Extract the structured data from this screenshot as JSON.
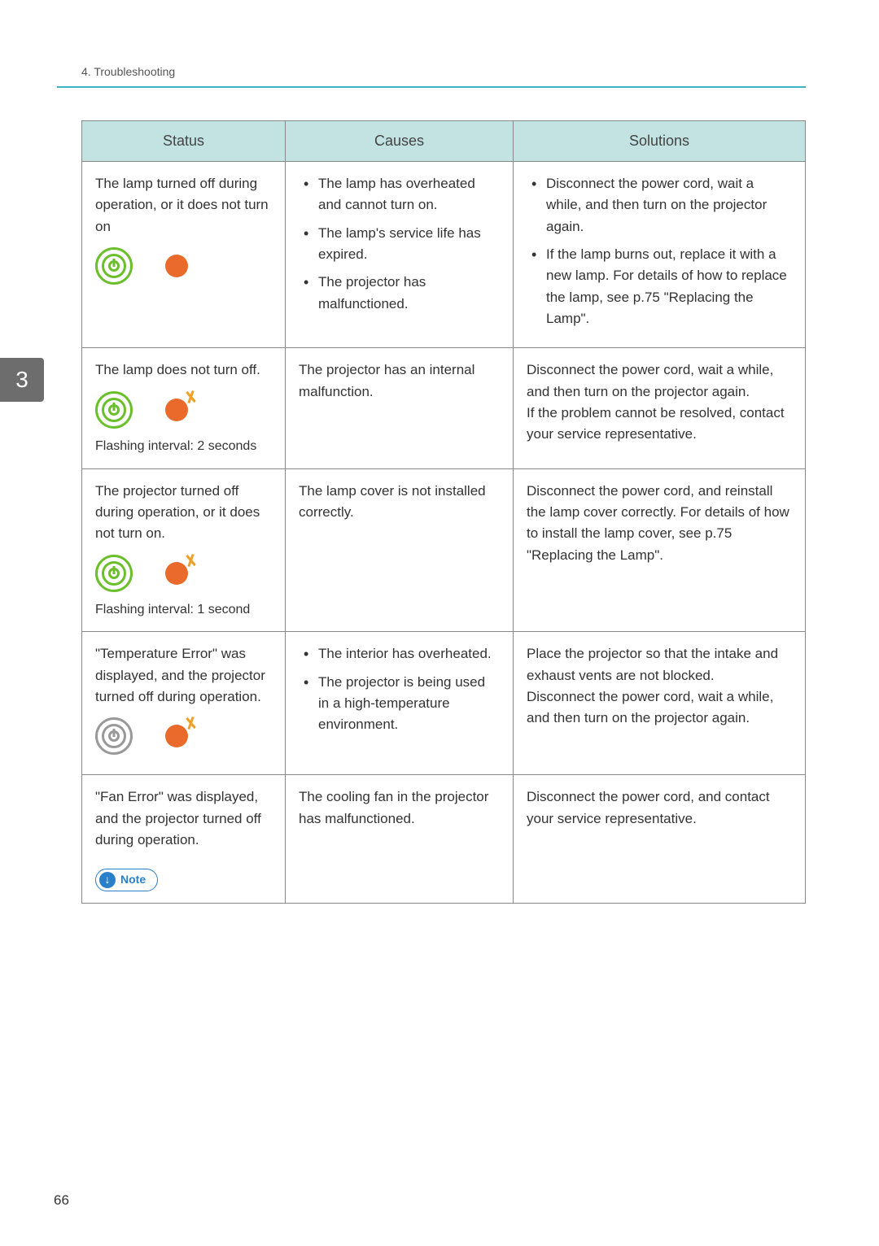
{
  "header": {
    "section": "4. Troubleshooting"
  },
  "side_tab": "3",
  "page_number": "66",
  "note_label": "Note",
  "table": {
    "headers": {
      "status": "Status",
      "causes": "Causes",
      "solutions": "Solutions"
    },
    "rows": [
      {
        "status_text": "The lamp turned off during operation, or it does not turn on",
        "status_footnote": "",
        "causes_items": [
          "The lamp has overheated and cannot turn on.",
          "The lamp's service life has expired.",
          "The projector has malfunctioned."
        ],
        "solutions_items": [
          "Disconnect the power cord, wait a while, and then turn on the projector again.",
          "If the lamp burns out, replace it with a new lamp. For details of how to replace the lamp, see p.75 \"Replacing the Lamp\"."
        ],
        "solutions_plain": "",
        "icons": {
          "power_lit": true,
          "led_type": "solid"
        }
      },
      {
        "status_text": "The lamp does not turn off.",
        "status_footnote": "Flashing interval: 2 seconds",
        "causes_plain": "The projector has an internal malfunction.",
        "solutions_plain": "Disconnect the power cord, wait a while, and then turn on the projector again.\nIf the problem cannot be resolved, contact your service representative.",
        "icons": {
          "power_lit": true,
          "led_type": "flash"
        }
      },
      {
        "status_text": "The projector turned off during operation, or it does not turn on.",
        "status_footnote": "Flashing interval: 1 second",
        "causes_plain": "The lamp cover is not installed correctly.",
        "solutions_plain": "Disconnect the power cord, and reinstall the lamp cover correctly. For details of how to install the lamp cover, see p.75 \"Replacing the Lamp\".",
        "icons": {
          "power_lit": true,
          "led_type": "flash"
        }
      },
      {
        "status_text": "\"Temperature Error\" was displayed, and the projector turned off during operation.",
        "status_footnote": "",
        "causes_items": [
          "The interior has overheated.",
          "The projector is being used in a high-temperature environment."
        ],
        "solutions_plain": "Place the projector so that the intake and exhaust vents are not blocked.\nDisconnect the power cord, wait a while, and then turn on the projector again.",
        "icons": {
          "power_lit": false,
          "led_type": "flash"
        }
      },
      {
        "status_text": "\"Fan Error\" was displayed, and the projector turned off during operation.",
        "status_footnote": "",
        "causes_plain": "The cooling fan in the projector has malfunctioned.",
        "solutions_plain": "Disconnect the power cord, and contact your service representative.",
        "show_note": true,
        "icons": null
      }
    ]
  }
}
